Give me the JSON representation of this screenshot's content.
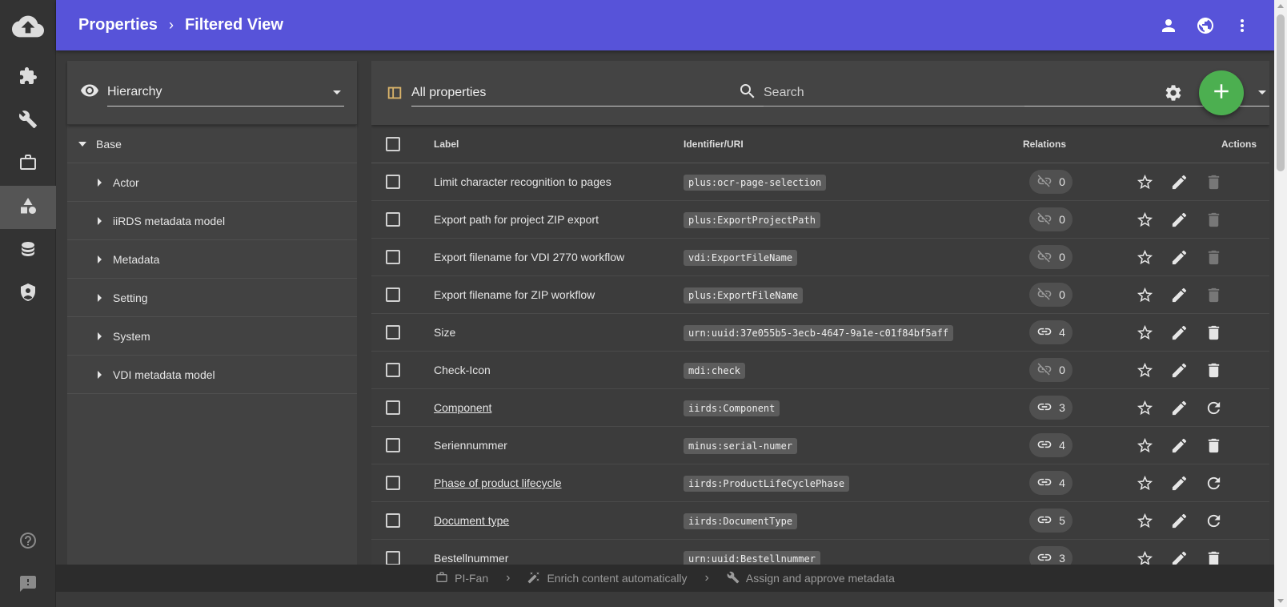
{
  "header": {
    "breadcrumb": [
      "Properties",
      "Filtered View"
    ],
    "breadcrumb_separator": "›",
    "actions": [
      "account-icon",
      "globe-icon",
      "more-vertical-icon"
    ],
    "background": "#5753d9"
  },
  "rail": {
    "logo": "cloud-upload-icon",
    "items": [
      "puzzle-icon",
      "wrench-icon",
      "briefcase-icon",
      "shapes-icon",
      "database-icon",
      "shield-account-icon"
    ],
    "active": "shapes-icon",
    "bottom": [
      "help-icon",
      "feedback-icon"
    ]
  },
  "tree": {
    "view_selector": "Hierarchy",
    "root": "Base",
    "children": [
      "Actor",
      "iiRDS metadata model",
      "Metadata",
      "Setting",
      "System",
      "VDI metadata model"
    ]
  },
  "toolbar": {
    "filter_selector": "All properties",
    "search_placeholder": "Search"
  },
  "table": {
    "columns": {
      "label": "Label",
      "identifier": "Identifier/URI",
      "relations": "Relations",
      "actions": "Actions"
    },
    "rows": [
      {
        "label": "Limit character recognition to pages",
        "id": "plus:ocr-page-selection",
        "relations": "0",
        "linked": false,
        "last_action": "delete-disabled",
        "link": false
      },
      {
        "label": "Export path for project ZIP export",
        "id": "plus:ExportProjectPath",
        "relations": "0",
        "linked": false,
        "last_action": "delete-disabled",
        "link": false
      },
      {
        "label": "Export filename for VDI 2770 workflow",
        "id": "vdi:ExportFileName",
        "relations": "0",
        "linked": false,
        "last_action": "delete-disabled",
        "link": false
      },
      {
        "label": "Export filename for ZIP workflow",
        "id": "plus:ExportFileName",
        "relations": "0",
        "linked": false,
        "last_action": "delete-disabled",
        "link": false
      },
      {
        "label": "Size",
        "id": "urn:uuid:37e055b5-3ecb-4647-9a1e-c01f84bf5aff",
        "relations": "4",
        "linked": true,
        "last_action": "delete",
        "link": false
      },
      {
        "label": "Check-Icon",
        "id": "mdi:check",
        "relations": "0",
        "linked": false,
        "last_action": "delete",
        "link": false
      },
      {
        "label": "Component ",
        "id": "iirds:Component",
        "relations": "3",
        "linked": true,
        "last_action": "reset",
        "link": true
      },
      {
        "label": "Seriennummer",
        "id": "minus:serial-numer",
        "relations": "4",
        "linked": true,
        "last_action": "delete",
        "link": false
      },
      {
        "label": "Phase of product lifecycle ",
        "id": "iirds:ProductLifeCyclePhase",
        "relations": "4",
        "linked": true,
        "last_action": "reset",
        "link": true
      },
      {
        "label": "Document type ",
        "id": "iirds:DocumentType",
        "relations": "5",
        "linked": true,
        "last_action": "reset",
        "link": true
      },
      {
        "label": "Bestellnummer",
        "id": "urn:uuid:Bestellnummer",
        "relations": "3",
        "linked": true,
        "last_action": "delete",
        "link": false
      }
    ]
  },
  "statusbar": {
    "steps": [
      {
        "icon": "briefcase-icon",
        "label": "PI-Fan"
      },
      {
        "icon": "magic-wand-icon",
        "label": "Enrich content automatically"
      },
      {
        "icon": "wrench-icon",
        "label": "Assign and approve metadata"
      }
    ]
  },
  "colors": {
    "fab": "#4caf50",
    "accent_filter": "#d9b36a"
  }
}
